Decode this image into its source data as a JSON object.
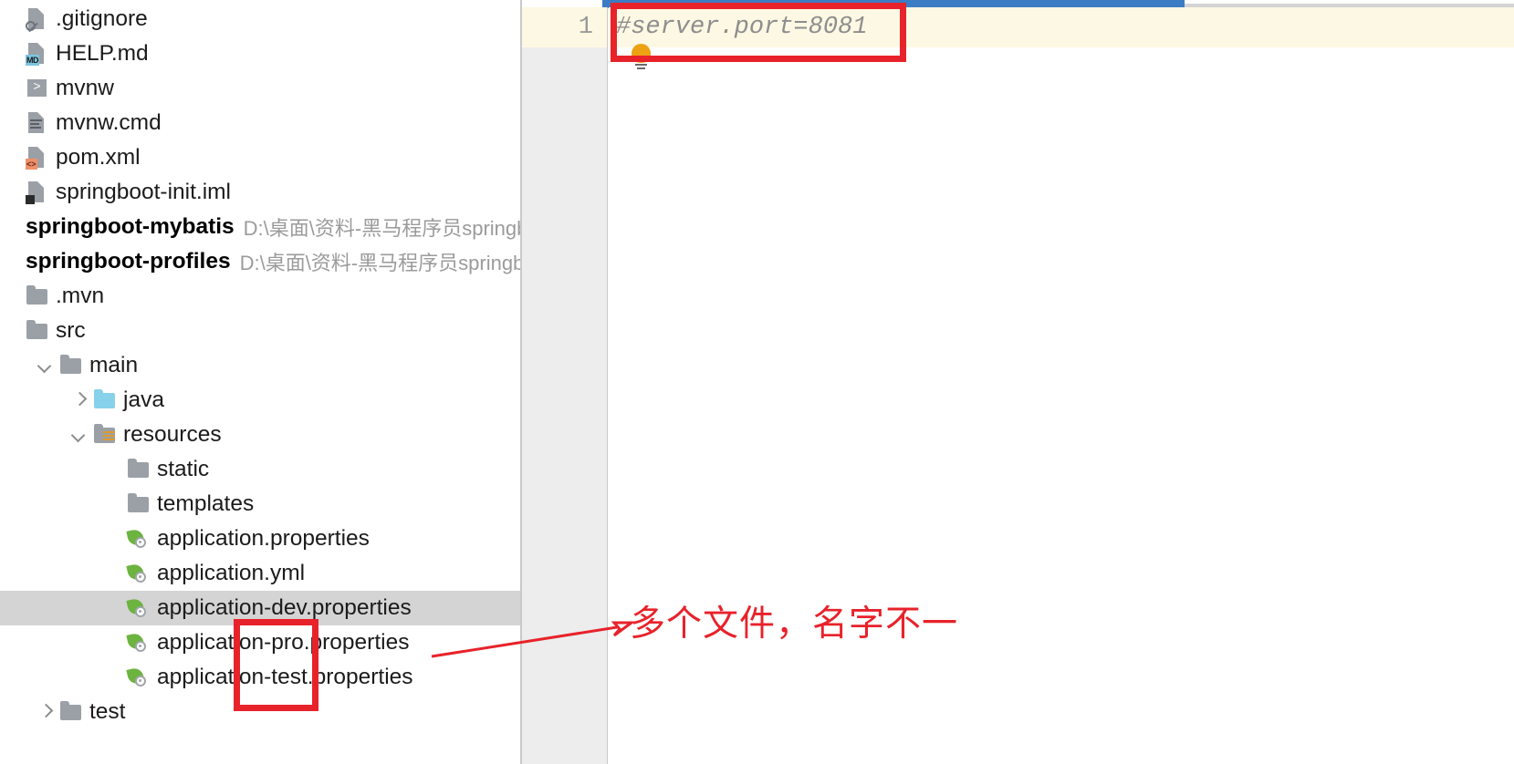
{
  "project_tree": {
    "scrollbar": {
      "name": "vertical-scrollbar"
    },
    "rows": [
      {
        "label": ".gitignore",
        "icon": "gitignore-file-icon",
        "indent": 0,
        "twisty": "none",
        "type": "file",
        "selected": false
      },
      {
        "label": "HELP.md",
        "icon": "markdown-file-icon",
        "indent": 0,
        "twisty": "none",
        "type": "file",
        "selected": false
      },
      {
        "label": "mvnw",
        "icon": "shell-script-file-icon",
        "indent": 0,
        "twisty": "none",
        "type": "file",
        "selected": false
      },
      {
        "label": "mvnw.cmd",
        "icon": "text-file-icon",
        "indent": 0,
        "twisty": "none",
        "type": "file",
        "selected": false
      },
      {
        "label": "pom.xml",
        "icon": "xml-file-icon",
        "indent": 0,
        "twisty": "none",
        "type": "file",
        "selected": false
      },
      {
        "label": "springboot-init.iml",
        "icon": "iml-module-file-icon",
        "indent": 0,
        "twisty": "none",
        "type": "file",
        "selected": false
      },
      {
        "label": "springboot-mybatis",
        "path": "D:\\桌面\\资料-黑马程序员springb",
        "icon": "module-icon",
        "indent": 0,
        "twisty": "none",
        "type": "module",
        "selected": false
      },
      {
        "label": "springboot-profiles",
        "path": "D:\\桌面\\资料-黑马程序员springb",
        "icon": "module-icon",
        "indent": 0,
        "twisty": "none",
        "type": "module",
        "selected": false
      },
      {
        "label": ".mvn",
        "icon": "folder-icon",
        "indent": 0,
        "twisty": "none",
        "type": "folder",
        "selected": false
      },
      {
        "label": "src",
        "icon": "folder-icon",
        "indent": 0,
        "twisty": "none",
        "type": "folder",
        "selected": false
      },
      {
        "label": "main",
        "icon": "folder-icon",
        "indent": 1,
        "twisty": "expanded",
        "type": "folder",
        "selected": false
      },
      {
        "label": "java",
        "icon": "source-folder-icon",
        "indent": 2,
        "twisty": "collapsed",
        "type": "folder",
        "selected": false
      },
      {
        "label": "resources",
        "icon": "resources-folder-icon",
        "indent": 2,
        "twisty": "expanded",
        "type": "folder",
        "selected": false
      },
      {
        "label": "static",
        "icon": "folder-icon",
        "indent": 3,
        "twisty": "none",
        "type": "folder",
        "selected": false
      },
      {
        "label": "templates",
        "icon": "folder-icon",
        "indent": 3,
        "twisty": "none",
        "type": "folder",
        "selected": false
      },
      {
        "label": "application.properties",
        "icon": "spring-config-file-icon",
        "indent": 3,
        "twisty": "none",
        "type": "file",
        "selected": false
      },
      {
        "label": "application.yml",
        "icon": "spring-config-file-icon",
        "indent": 3,
        "twisty": "none",
        "type": "file",
        "selected": false
      },
      {
        "label": "application-dev.properties",
        "icon": "spring-config-file-icon",
        "indent": 3,
        "twisty": "none",
        "type": "file",
        "selected": true
      },
      {
        "label": "application-pro.properties",
        "icon": "spring-config-file-icon",
        "indent": 3,
        "twisty": "none",
        "type": "file",
        "selected": false
      },
      {
        "label": "application-test.properties",
        "icon": "spring-config-file-icon",
        "indent": 3,
        "twisty": "none",
        "type": "file",
        "selected": false
      },
      {
        "label": "test",
        "icon": "folder-icon",
        "indent": 1,
        "twisty": "collapsed",
        "type": "folder",
        "selected": false
      }
    ]
  },
  "editor": {
    "line_number": "1",
    "code_line": "#server.port=8081",
    "intention_icon": "lightbulb-icon",
    "tab_indicator_color": "#3c7cc4",
    "line_highlight_color": "#fdf8e3",
    "comment_color": "#8d8d8d"
  },
  "annotations": {
    "color": "#e8222a",
    "note_text": "多个文件，名字不一",
    "box_code_name": "highlight-box-code-line",
    "box_files_name": "highlight-box-profile-names",
    "arrow_name": "annotation-arrow"
  }
}
